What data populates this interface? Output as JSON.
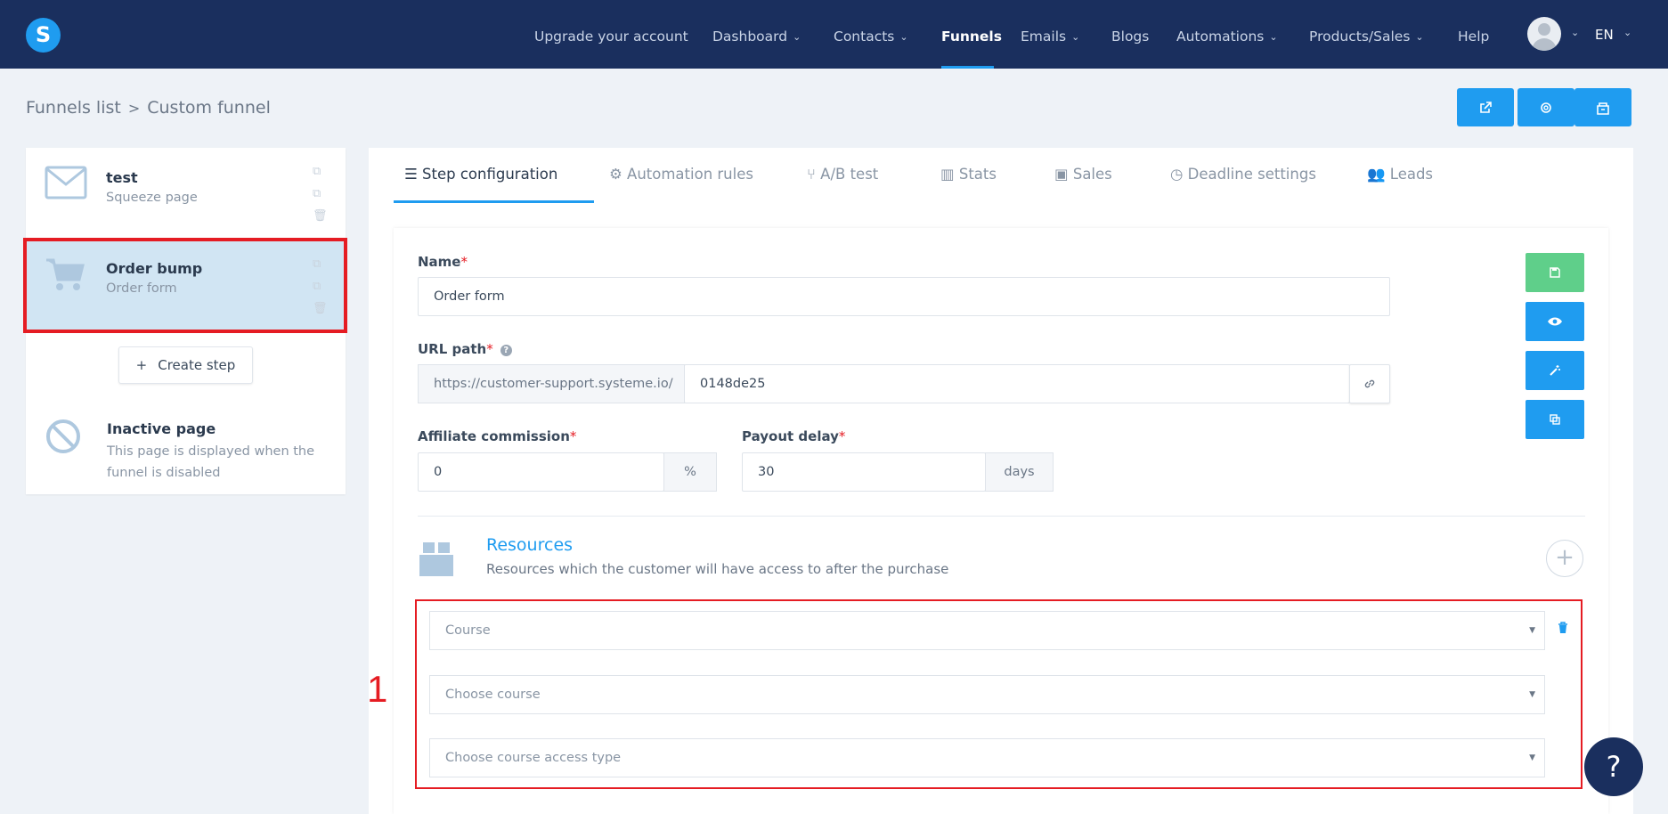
{
  "brand": {
    "logo_letter": "S"
  },
  "nav": {
    "items": [
      {
        "label": "Upgrade your account",
        "caret": false
      },
      {
        "label": "Dashboard",
        "caret": true
      },
      {
        "label": "Contacts",
        "caret": true
      },
      {
        "label": "Funnels",
        "caret": false,
        "active": true
      },
      {
        "label": "Emails",
        "caret": true
      },
      {
        "label": "Blogs",
        "caret": false
      },
      {
        "label": "Automations",
        "caret": true
      },
      {
        "label": "Products/Sales",
        "caret": true
      },
      {
        "label": "Help",
        "caret": false
      }
    ],
    "language": "EN"
  },
  "breadcrumb": {
    "parent": "Funnels list",
    "separator": ">",
    "current": "Custom funnel"
  },
  "header_buttons": [
    "external-link-icon",
    "settings-icon",
    "marketplace-icon"
  ],
  "steps": [
    {
      "title": "test",
      "subtitle": "Squeeze page",
      "icon": "envelope-icon",
      "selected": false
    },
    {
      "title": "Order bump",
      "subtitle": "Order form",
      "icon": "cart-icon",
      "selected": true
    }
  ],
  "create_step": {
    "plus": "+",
    "label": "Create step"
  },
  "inactive_page": {
    "title": "Inactive page",
    "subtitle_line1": "This page is displayed when the",
    "subtitle_line2": "funnel is disabled"
  },
  "tabs": [
    {
      "label": "Step configuration",
      "icon": "list-icon",
      "active": true
    },
    {
      "label": "Automation rules",
      "icon": "gears-icon"
    },
    {
      "label": "A/B test",
      "icon": "split-icon"
    },
    {
      "label": "Stats",
      "icon": "bar-chart-icon"
    },
    {
      "label": "Sales",
      "icon": "money-icon"
    },
    {
      "label": "Deadline settings",
      "icon": "clock-icon"
    },
    {
      "label": "Leads",
      "icon": "users-icon"
    }
  ],
  "form": {
    "name_label": "Name",
    "name_value": "Order form",
    "url_label": "URL path",
    "url_prefix": "https://customer-support.systeme.io/",
    "url_value": "0148de25",
    "affiliate_label": "Affiliate commission",
    "affiliate_value": "0",
    "affiliate_unit": "%",
    "payout_label": "Payout delay",
    "payout_value": "30",
    "payout_unit": "days",
    "required_mark": "*"
  },
  "side_buttons": [
    {
      "icon": "save-icon",
      "color": "#5fcf8a"
    },
    {
      "icon": "eye-icon",
      "color": "#1f9cf0"
    },
    {
      "icon": "magic-wand-icon",
      "color": "#1f9cf0"
    },
    {
      "icon": "copy-icon",
      "color": "#1f9cf0"
    }
  ],
  "resources": {
    "title": "Resources",
    "subtitle": "Resources which the customer will have access to after the purchase",
    "add_symbol": "+",
    "selects": [
      {
        "placeholder": "Course"
      },
      {
        "placeholder": "Choose course"
      },
      {
        "placeholder": "Choose course access type"
      }
    ]
  },
  "annotation": "1",
  "help_fab": "?",
  "colors": {
    "nav_bg": "#1a2f5e",
    "accent": "#1f9cf0",
    "highlight": "#e51c23",
    "selected_bg": "#d1e5f3",
    "save_green": "#5fcf8a"
  }
}
